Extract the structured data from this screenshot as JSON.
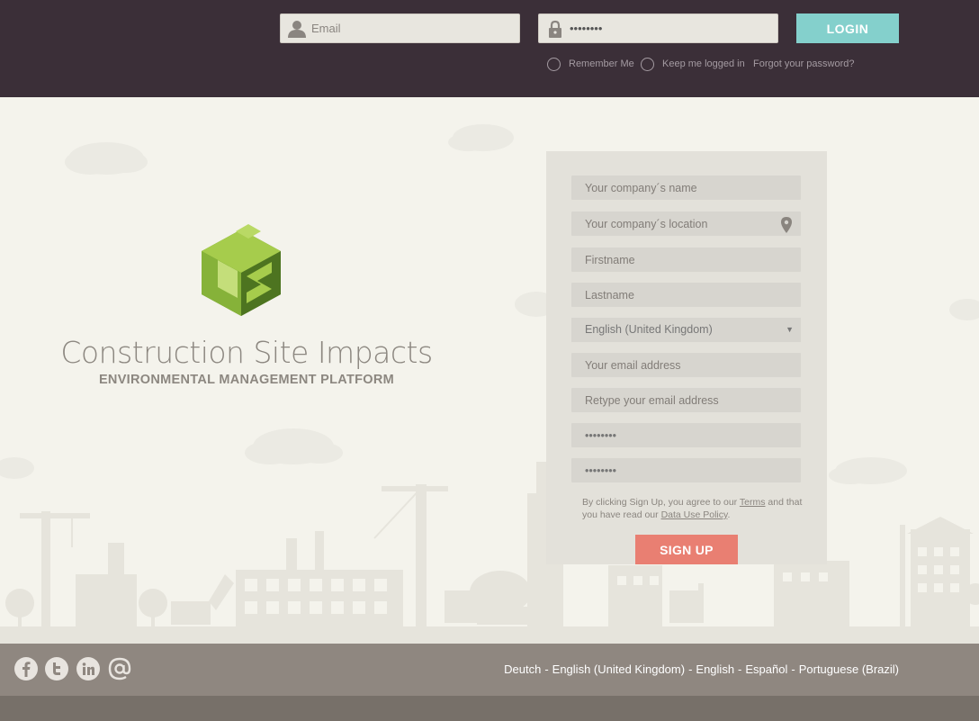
{
  "topbar": {
    "email_placeholder": "Email",
    "password_value": "••••••••",
    "login_label": "LOGIN",
    "remember_label": "Remember Me",
    "keep_label": "Keep me logged in",
    "forgot_label": "Forgot your password?"
  },
  "brand": {
    "title": "Construction Site Impacts",
    "subtitle": "ENVIRONMENTAL MANAGEMENT PLATFORM"
  },
  "signup": {
    "company_name_placeholder": "Your company´s name",
    "company_location_placeholder": "Your company´s location",
    "firstname_placeholder": "Firstname",
    "lastname_placeholder": "Lastname",
    "language_value": "English (United Kingdom)",
    "email_placeholder": "Your email address",
    "retype_email_placeholder": "Retype your email address",
    "password_value": "••••••••",
    "password_confirm_value": "••••••••",
    "terms_prefix": "By clicking Sign Up, you agree to our ",
    "terms_link": "Terms",
    "terms_middle": " and that you have read our ",
    "policy_link": "Data Use Policy",
    "terms_suffix": ".",
    "signup_label": "SIGN UP"
  },
  "footer": {
    "social_icons": [
      "facebook-icon",
      "twitter-icon",
      "linkedin-icon",
      "at-icon"
    ],
    "languages": [
      "Deutch",
      "English (United Kingdom)",
      "English",
      "Español",
      "Portuguese (Brazil)"
    ]
  },
  "colors": {
    "topbar": "#3b2f38",
    "login": "#84d0cc",
    "signup": "#e97f72",
    "footer": "#8f8780",
    "background": "#f4f3ec"
  }
}
